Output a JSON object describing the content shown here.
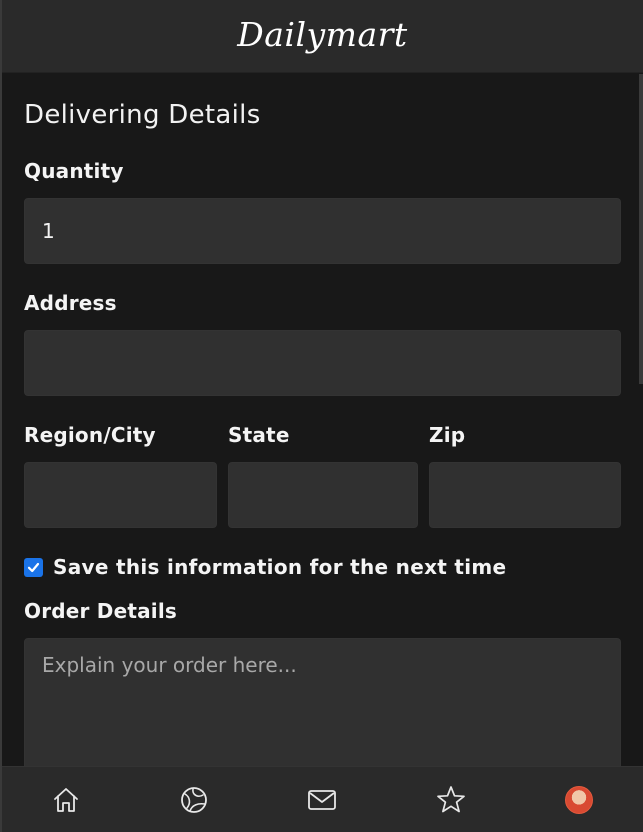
{
  "header": {
    "logo": "Dailymart"
  },
  "form": {
    "title": "Delivering Details",
    "quantity": {
      "label": "Quantity",
      "value": "1"
    },
    "address": {
      "label": "Address",
      "value": ""
    },
    "region": {
      "label": "Region/City",
      "value": ""
    },
    "state": {
      "label": "State",
      "value": ""
    },
    "zip": {
      "label": "Zip",
      "value": ""
    },
    "save_info": {
      "label": "Save this information for the next time",
      "checked": true
    },
    "order_details": {
      "label": "Order Details",
      "placeholder": "Explain your order here..."
    }
  },
  "bottom_nav": {
    "items": [
      {
        "icon": "home-icon"
      },
      {
        "icon": "globe-icon"
      },
      {
        "icon": "mail-icon"
      },
      {
        "icon": "star-icon"
      },
      {
        "icon": "avatar"
      }
    ]
  },
  "colors": {
    "checkbox": "#1a73e8",
    "background": "#181818",
    "field": "#303030"
  }
}
